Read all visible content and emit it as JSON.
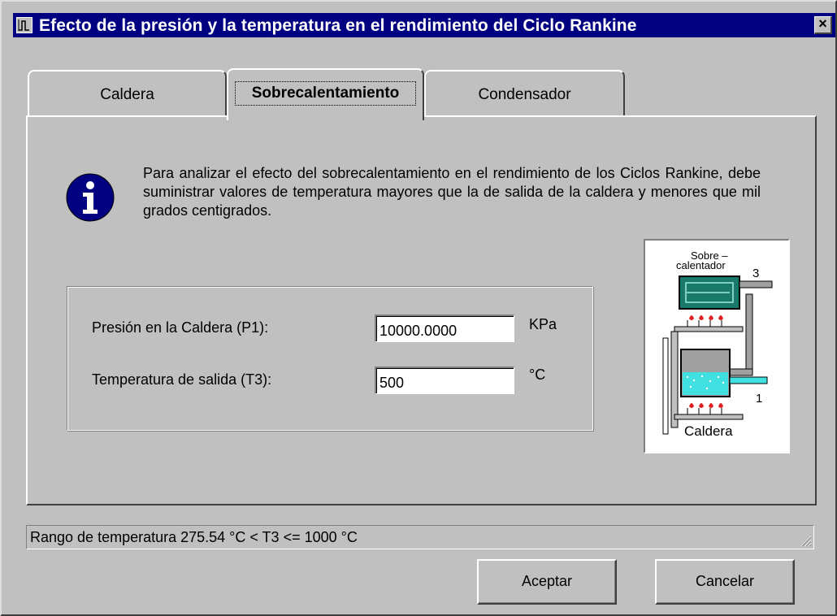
{
  "window": {
    "title": "Efecto de la presión y la temperatura en el rendimiento del Ciclo Rankine",
    "close_glyph": "×"
  },
  "tabs": [
    {
      "label": "Caldera",
      "selected": false
    },
    {
      "label": "Sobrecalentamiento",
      "selected": true
    },
    {
      "label": "Condensador",
      "selected": false
    }
  ],
  "info": {
    "icon": "info-icon",
    "text": "Para analizar el efecto del sobrecalentamiento  en el rendimiento de los Ciclos Rankine, debe suministrar valores de temperatura mayores que la de salida de la caldera y menores que mil grados centigrados."
  },
  "form": {
    "pressure": {
      "label": "Presión en la Caldera (P1):",
      "value": "10000.0000",
      "unit": "KPa"
    },
    "temperature": {
      "label": "Temperatura de salida (T3):",
      "value": "500",
      "unit": "°C"
    }
  },
  "diagram": {
    "label_sobre_1": "Sobre –",
    "label_sobre_2": "calentador",
    "point_3": "3",
    "point_1": "1",
    "label_caldera": "Caldera"
  },
  "status": {
    "text": "Rango de temperatura 275.54 °C < T3 <= 1000 °C"
  },
  "buttons": {
    "ok": "Aceptar",
    "cancel": "Cancelar"
  },
  "colors": {
    "title_bar": "#000080",
    "face": "#c0c0c0",
    "water": "#40e0e0",
    "heater": "#1a7a6a",
    "flame": "#e02020"
  }
}
